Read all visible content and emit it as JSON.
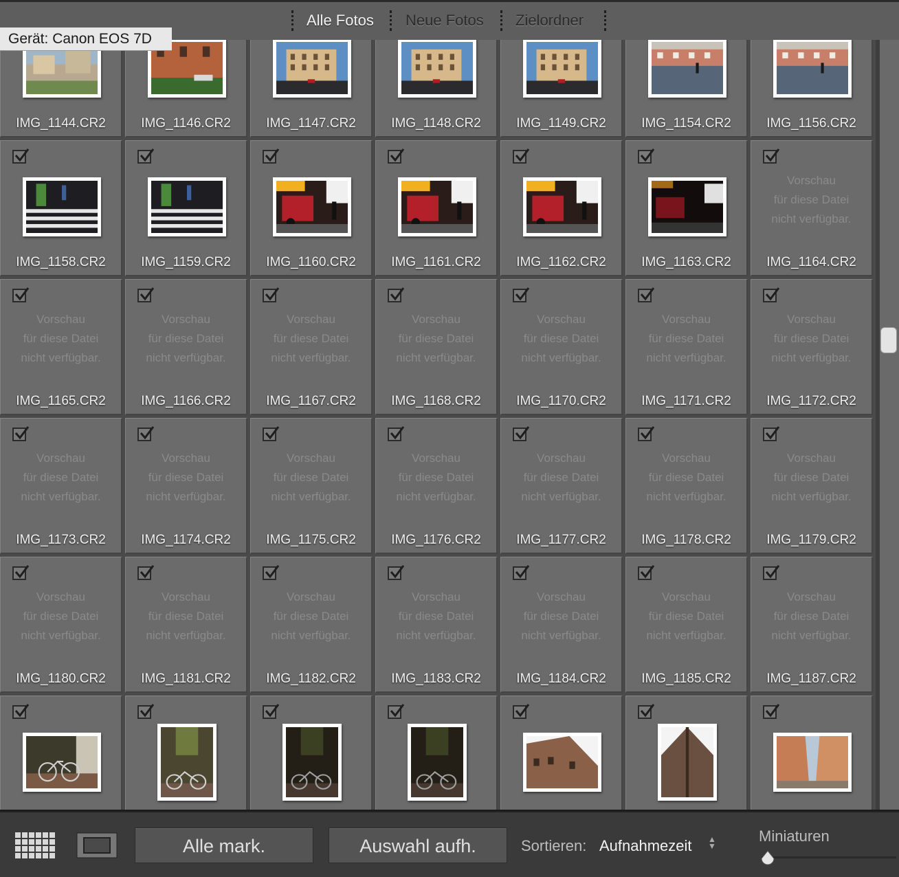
{
  "header": {
    "tabs": [
      {
        "label": "Alle Fotos",
        "active": true
      },
      {
        "label": "Neue Fotos",
        "active": false
      },
      {
        "label": "Zielordner",
        "active": false
      }
    ]
  },
  "device_label": "Gerät: Canon EOS 7D",
  "no_preview_text": [
    "Vorschau",
    "für diese Datei",
    "nicht verfügbar."
  ],
  "photos": [
    {
      "name": "IMG_1144.CR2",
      "preview": "piazza-landscape",
      "checked": true
    },
    {
      "name": "IMG_1146.CR2",
      "preview": "building-street",
      "checked": true
    },
    {
      "name": "IMG_1147.CR2",
      "preview": "palazzo",
      "checked": true
    },
    {
      "name": "IMG_1148.CR2",
      "preview": "palazzo",
      "checked": true
    },
    {
      "name": "IMG_1149.CR2",
      "preview": "palazzo",
      "checked": true
    },
    {
      "name": "IMG_1154.CR2",
      "preview": "wet-square",
      "checked": true
    },
    {
      "name": "IMG_1156.CR2",
      "preview": "wet-square",
      "checked": true
    },
    {
      "name": "IMG_1158.CR2",
      "preview": "crosswalk",
      "checked": true
    },
    {
      "name": "IMG_1159.CR2",
      "preview": "crosswalk",
      "checked": true
    },
    {
      "name": "IMG_1160.CR2",
      "preview": "red-vehicle",
      "checked": true
    },
    {
      "name": "IMG_1161.CR2",
      "preview": "red-vehicle",
      "checked": true
    },
    {
      "name": "IMG_1162.CR2",
      "preview": "red-vehicle",
      "checked": true
    },
    {
      "name": "IMG_1163.CR2",
      "preview": "red-vehicle-dark",
      "checked": true
    },
    {
      "name": "IMG_1164.CR2",
      "preview": null,
      "checked": true
    },
    {
      "name": "IMG_1165.CR2",
      "preview": null,
      "checked": true
    },
    {
      "name": "IMG_1166.CR2",
      "preview": null,
      "checked": true
    },
    {
      "name": "IMG_1167.CR2",
      "preview": null,
      "checked": true
    },
    {
      "name": "IMG_1168.CR2",
      "preview": null,
      "checked": true
    },
    {
      "name": "IMG_1170.CR2",
      "preview": null,
      "checked": true
    },
    {
      "name": "IMG_1171.CR2",
      "preview": null,
      "checked": true
    },
    {
      "name": "IMG_1172.CR2",
      "preview": null,
      "checked": true
    },
    {
      "name": "IMG_1173.CR2",
      "preview": null,
      "checked": true
    },
    {
      "name": "IMG_1174.CR2",
      "preview": null,
      "checked": true
    },
    {
      "name": "IMG_1175.CR2",
      "preview": null,
      "checked": true
    },
    {
      "name": "IMG_1176.CR2",
      "preview": null,
      "checked": true
    },
    {
      "name": "IMG_1177.CR2",
      "preview": null,
      "checked": true
    },
    {
      "name": "IMG_1178.CR2",
      "preview": null,
      "checked": true
    },
    {
      "name": "IMG_1179.CR2",
      "preview": null,
      "checked": true
    },
    {
      "name": "IMG_1180.CR2",
      "preview": null,
      "checked": true
    },
    {
      "name": "IMG_1181.CR2",
      "preview": null,
      "checked": true
    },
    {
      "name": "IMG_1182.CR2",
      "preview": null,
      "checked": true
    },
    {
      "name": "IMG_1183.CR2",
      "preview": null,
      "checked": true
    },
    {
      "name": "IMG_1184.CR2",
      "preview": null,
      "checked": true
    },
    {
      "name": "IMG_1185.CR2",
      "preview": null,
      "checked": true
    },
    {
      "name": "IMG_1187.CR2",
      "preview": null,
      "checked": true
    },
    {
      "name": "",
      "preview": "bicycle-landscape",
      "checked": true
    },
    {
      "name": "",
      "preview": "bicycle-portrait",
      "checked": true
    },
    {
      "name": "",
      "preview": "bicycle-portrait-dark",
      "checked": true
    },
    {
      "name": "",
      "preview": "bicycle-portrait-dark",
      "checked": true
    },
    {
      "name": "",
      "preview": "building-corner-landscape",
      "checked": true
    },
    {
      "name": "",
      "preview": "building-corner-portrait",
      "checked": true
    },
    {
      "name": "",
      "preview": "alley",
      "checked": true
    }
  ],
  "toolbar": {
    "select_all_label": "Alle mark.",
    "deselect_label": "Auswahl aufh.",
    "sort_label": "Sortieren:",
    "sort_value": "Aufnahmezeit",
    "thumbnails_label": "Miniaturen",
    "thumbnail_size": 0
  },
  "colors": {
    "panel": "#6b6b6b",
    "background": "#3a3a3a",
    "text": "#efefef",
    "no_preview_text": "#8a8a8a"
  }
}
